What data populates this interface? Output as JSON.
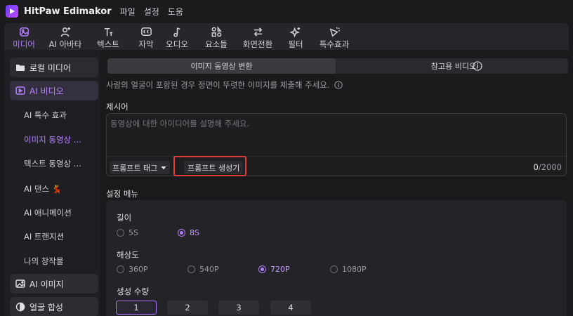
{
  "app": {
    "title": "HitPaw Edimakor",
    "menu": [
      "파일",
      "설정",
      "도움"
    ]
  },
  "toolbar": {
    "tools": [
      {
        "label": "미디어",
        "icon": "media-icon",
        "active": true
      },
      {
        "label": "AI 아바타",
        "icon": "avatar-icon"
      },
      {
        "label": "텍스트",
        "icon": "text-icon"
      },
      {
        "label": "자막",
        "icon": "subtitle-icon"
      },
      {
        "label": "오디오",
        "icon": "music-icon"
      },
      {
        "label": "요소들",
        "icon": "elements-icon"
      },
      {
        "label": "화면전환",
        "icon": "transition-icon"
      },
      {
        "label": "필터",
        "icon": "filter-icon"
      },
      {
        "label": "특수효과",
        "icon": "effects-icon"
      }
    ]
  },
  "sidebar": {
    "local_media": "로컬 미디어",
    "ai_video": "AI 비디오",
    "sub_items": [
      "AI 특수 효과",
      "이미지 동영상 ...",
      "텍스트 동영상 ...",
      "AI 댄스 💃",
      "AI 애니메이션",
      "AI 트랜지션",
      "나의 창작물"
    ],
    "ai_image": "AI 이미지",
    "face_swap": "얼굴 합성"
  },
  "tabs": {
    "image_to_video": "이미지 동영상 변환",
    "reference_video": "참고용 비디오"
  },
  "hint": "사람의 얼굴이 포함된 경우 정면이 뚜렷한 이미지를 제출해 주세요.",
  "prompt": {
    "label": "제시어",
    "placeholder": "동영상에 대한 아이디어를 설명해 주세요.",
    "tag_button": "프롬프트 태그",
    "generate_button": "프롬프트 생성기",
    "count": "0",
    "max": "/2000"
  },
  "settings": {
    "label": "설정 메뉴",
    "length": {
      "label": "길이",
      "options": [
        "5S",
        "8S"
      ],
      "selected": "8S"
    },
    "resolution": {
      "label": "해상도",
      "options": [
        "360P",
        "540P",
        "720P",
        "1080P"
      ],
      "selected": "720P"
    },
    "quantity": {
      "label": "생성 수량",
      "options": [
        "1",
        "2",
        "3",
        "4"
      ],
      "selected": "1"
    }
  },
  "colors": {
    "accent": "#b07cff",
    "highlight": "#e23b3b"
  }
}
